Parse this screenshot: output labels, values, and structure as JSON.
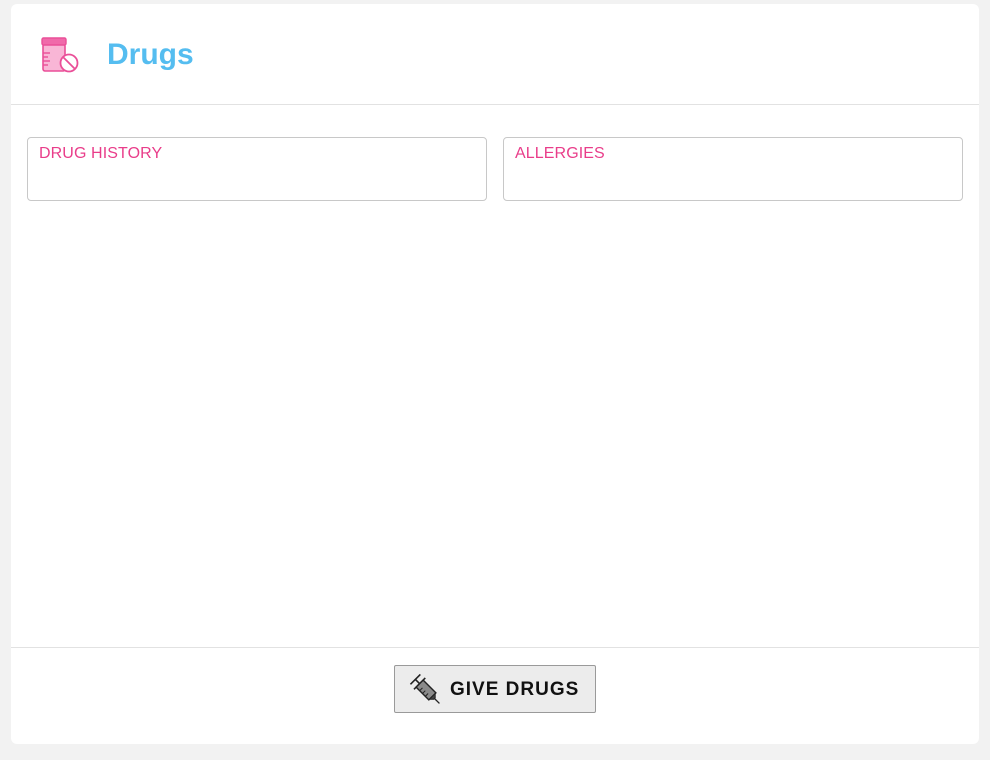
{
  "header": {
    "title": "Drugs",
    "icon": "pill-bottle-no-icon",
    "title_color": "#55bdf0",
    "icon_color": "#f06aaa"
  },
  "panels": {
    "drug_history": {
      "label": "DRUG HISTORY"
    },
    "allergies": {
      "label": "ALLERGIES"
    },
    "label_color": "#e93d8a"
  },
  "footer": {
    "give_button": {
      "label": "GIVE DRUGS",
      "icon": "syringe-icon"
    }
  }
}
